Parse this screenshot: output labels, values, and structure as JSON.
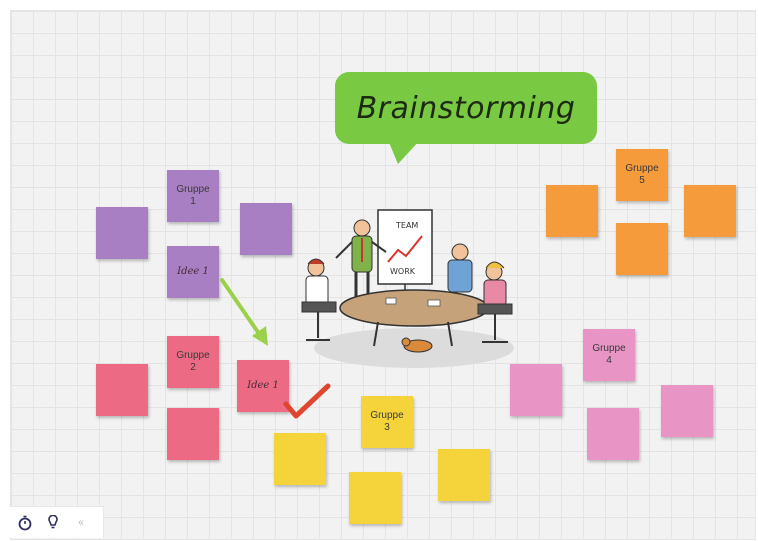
{
  "title": "Brainstorming",
  "groups": {
    "purple": {
      "label": "Gruppe\n1",
      "idea": "Idee 1",
      "color": "#a97fc3"
    },
    "red": {
      "label": "Gruppe\n2",
      "idea": "Idee 1",
      "color": "#ec6a83"
    },
    "yellow": {
      "label": "Gruppe\n3",
      "color": "#f4d43a"
    },
    "pink": {
      "label": "Gruppe\n4",
      "color": "#e895c6"
    },
    "orange": {
      "label": "Gruppe\n5",
      "color": "#f59b3b"
    }
  },
  "illustration": {
    "flipchart_top": "TEAM",
    "flipchart_bottom": "WORK"
  },
  "toolbar": {
    "timer_icon": "stopwatch-icon",
    "bulb_icon": "lightbulb-icon",
    "collapse_label": "«"
  },
  "colors": {
    "bubble": "#7ac943",
    "arrow": "#9bd14a",
    "check": "#e0452f"
  }
}
